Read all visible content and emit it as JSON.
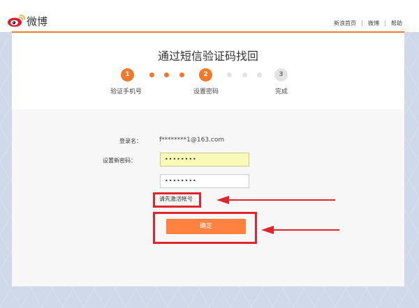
{
  "header": {
    "logo_text": "微博",
    "nav": [
      "新浪首页",
      "微博",
      "帮助"
    ]
  },
  "page": {
    "title": "通过短信验证码找回",
    "steps": [
      {
        "num": "1",
        "label": "验证手机号",
        "state": "active"
      },
      {
        "num": "2",
        "label": "设置密码",
        "state": "active"
      },
      {
        "num": "3",
        "label": "完成",
        "state": "pending"
      }
    ]
  },
  "form": {
    "login_label": "登录名：",
    "login_value": "f********1@163.com",
    "new_password_label": "设置新密码：",
    "new_password_value": "••••••••",
    "confirm_password_value": "••••••••",
    "hint": "请先激活帐号",
    "confirm_button": "确定"
  },
  "colors": {
    "accent": "#f07a2a",
    "button": "#ff8140",
    "annotation": "#e0242a"
  }
}
